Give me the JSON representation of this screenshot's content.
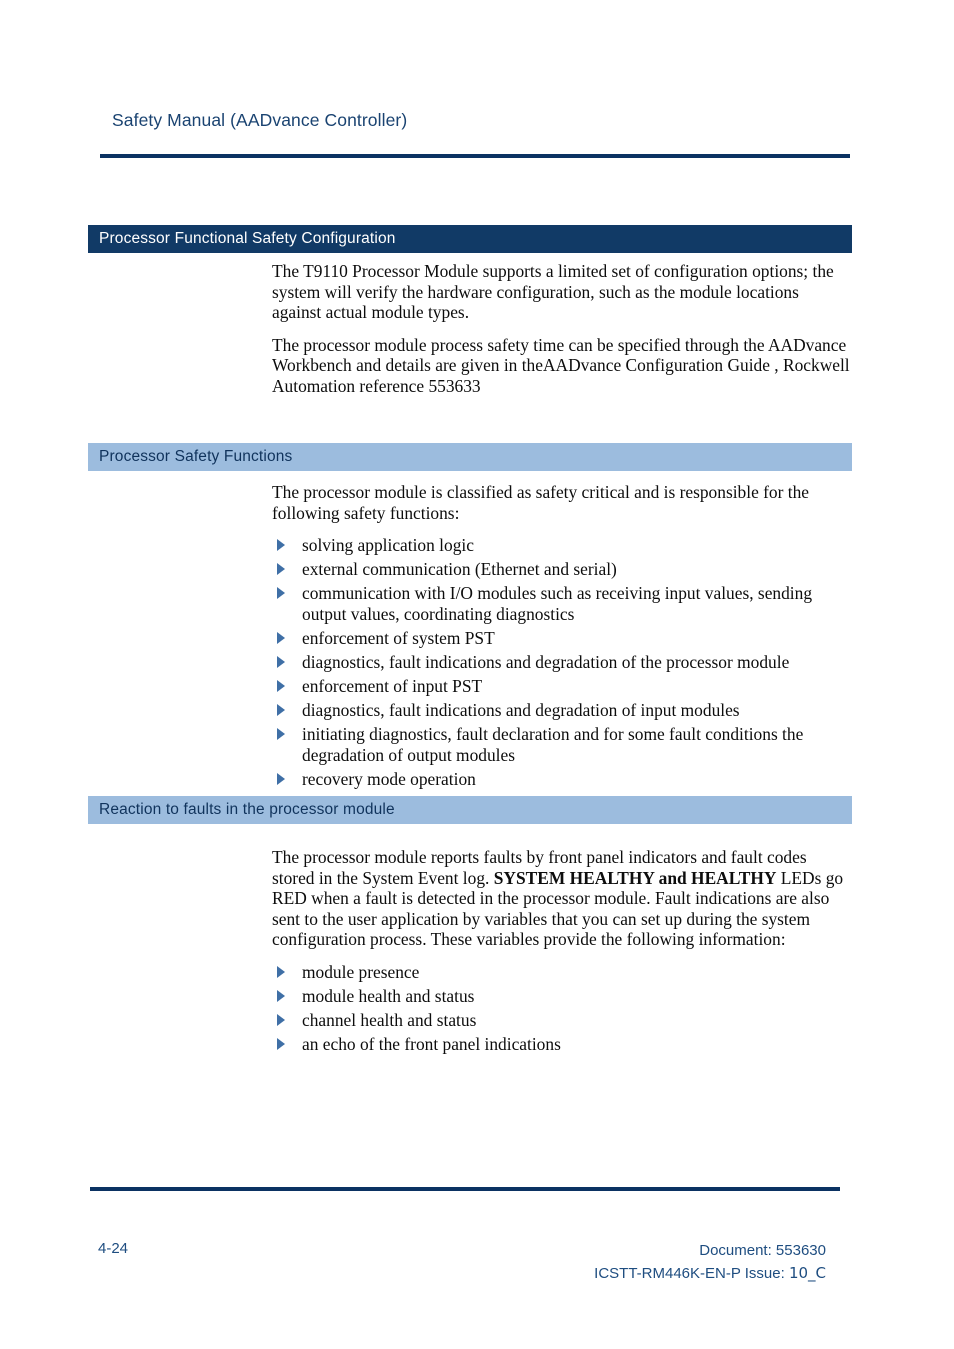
{
  "document": {
    "running_head": "Safety Manual (AADvance Controller)",
    "colors": {
      "rule": "#0b3262",
      "band_dark": "#113a66",
      "band_light": "#9cbcde",
      "heading_text_light_band": "#10335c",
      "bullet_arrow": "#3f6fa6",
      "footer_text": "#1e4d80",
      "running_head_text": "#1a4371"
    }
  },
  "sections": {
    "config": {
      "heading": "Processor Functional Safety Configuration",
      "paragraphs": [
        "The T9110 Processor Module supports a limited set of configuration options; the system will verify the hardware configuration, such as the module locations against actual module types.",
        "The processor module process safety time can be specified through the AADvance Workbench and details are given in theAADvance Configuration Guide , Rockwell Automation reference 553633"
      ]
    },
    "safety_functions": {
      "heading": "Processor Safety Functions",
      "intro": "The processor module is classified as safety critical and is responsible for the following safety functions:",
      "items": [
        "solving application logic",
        "external communication (Ethernet and serial)",
        "communication with I/O modules such as receiving input values, sending output values, coordinating diagnostics",
        "enforcement of system PST",
        "diagnostics, fault indications and degradation of the processor module",
        "enforcement of input PST",
        "diagnostics, fault indications and degradation of input modules",
        "initiating diagnostics, fault declaration and for some fault conditions the degradation of output modules",
        "recovery mode operation"
      ]
    },
    "faults": {
      "heading": "Reaction to faults in the processor module",
      "paragraph_part1": "The processor module reports faults by front panel indicators and fault codes stored in the System Event log. ",
      "paragraph_bold": "SYSTEM HEALTHY and HEALTHY",
      "paragraph_part2": " LEDs go RED when a fault is detected in the processor module. Fault indications are also sent to the user application by variables that you can set up during the system configuration process. These variables provide the following information:",
      "items": [
        "module presence",
        "module health and status",
        "channel health and status",
        "an echo of the front panel indications"
      ]
    }
  },
  "footer": {
    "page_number": "4-24",
    "document_line": "Document: 553630",
    "reference_prefix": "ICSTT-RM446K-EN-P Issue: ",
    "issue_value": "10_C"
  }
}
